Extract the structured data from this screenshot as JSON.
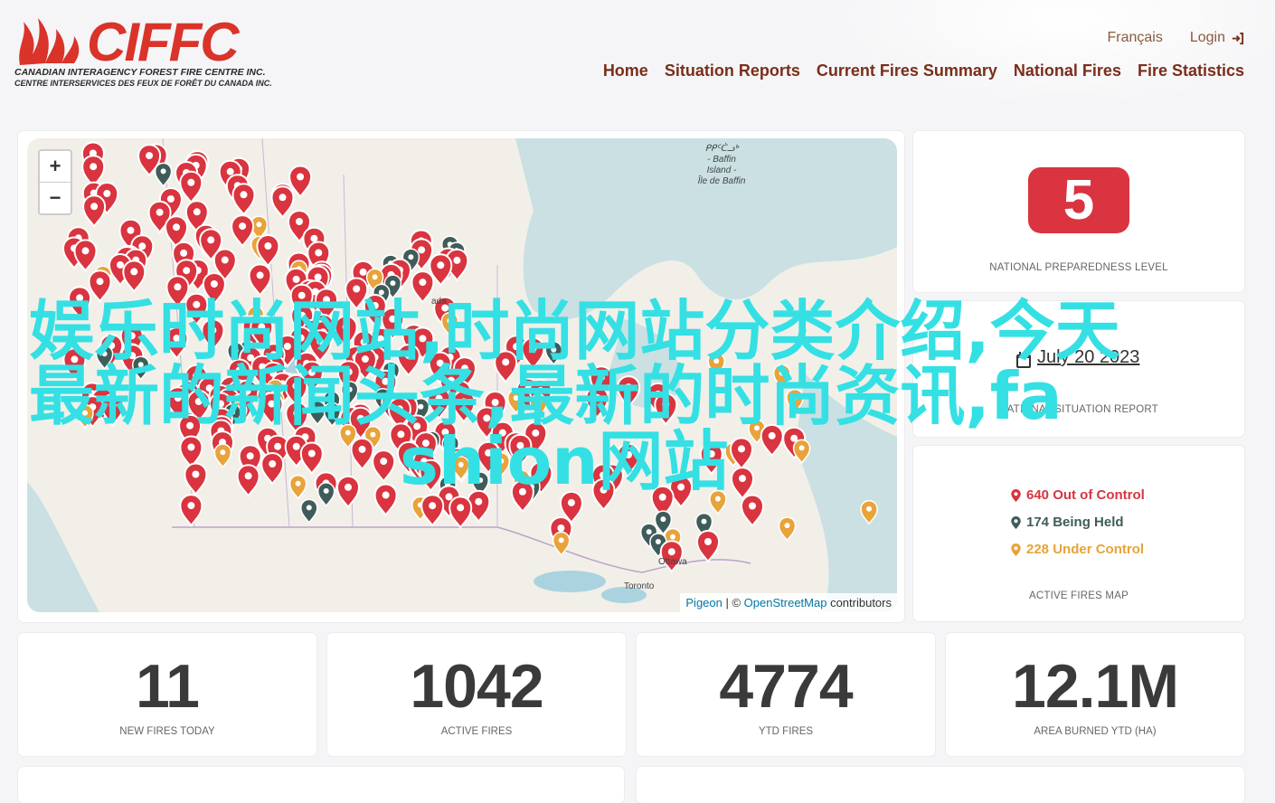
{
  "logo": {
    "wordmark": "CIFFC",
    "line1": "CANADIAN INTERAGENCY FOREST FIRE CENTRE INC.",
    "line2": "CENTRE INTERSERVICES DES FEUX DE FORÊT DU CANADA INC."
  },
  "top_links": {
    "language": "Français",
    "login": "Login"
  },
  "nav": [
    "Home",
    "Situation Reports",
    "Current Fires Summary",
    "National Fires",
    "Fire Statistics"
  ],
  "map": {
    "zoom_in": "+",
    "zoom_out": "−",
    "labels": {
      "baffin": "ᑭᑭᑦᑖᓗᒃ\n- Baffin\nIsland -\nÎle de Baffin",
      "ada": "ada",
      "ottawa": "Ottawa",
      "toronto": "Toronto"
    },
    "attribution": {
      "pigeon": "Pigeon",
      "sep": " | © ",
      "osm": "OpenStreetMap",
      "tail": " contributors"
    },
    "colors": {
      "out_of_control": "#d9343f",
      "being_held": "#3f5c5a",
      "under_control": "#e8a33a"
    }
  },
  "preparedness": {
    "level": "5",
    "caption": "NATIONAL PREPAREDNESS LEVEL"
  },
  "situation": {
    "date": "July 20 2023",
    "caption": "NATIONAL SITUATION REPORT"
  },
  "fires_map": {
    "out_of_control": "640 Out of Control",
    "being_held": "174 Being Held",
    "under_control": "228 Under Control",
    "caption": "ACTIVE FIRES MAP"
  },
  "stats": [
    {
      "value": "11",
      "label": "NEW FIRES TODAY"
    },
    {
      "value": "1042",
      "label": "ACTIVE FIRES"
    },
    {
      "value": "4774",
      "label": "YTD FIRES"
    },
    {
      "value": "12.1M",
      "label": "AREA BURNED YTD (HA)"
    }
  ],
  "overlay": {
    "line1": "娱乐时尚网站,时尚网站分类介绍,今天",
    "line2": "最新的新闻头条,最新的时尚资讯,fa",
    "line3": "shion网站"
  }
}
